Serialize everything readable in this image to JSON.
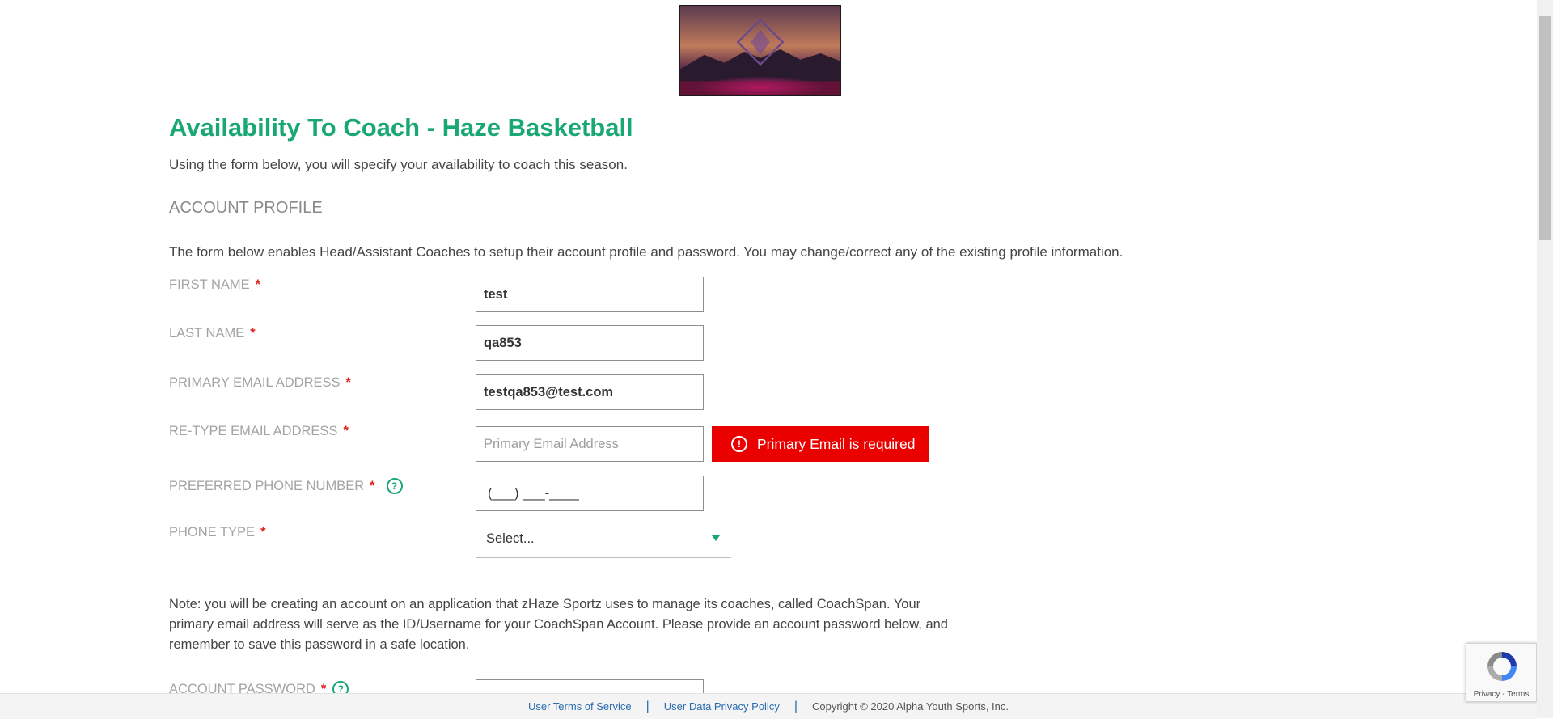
{
  "header": {
    "title": "Availability To Coach - Haze Basketball",
    "intro": "Using the form below, you will specify your availability to coach this season."
  },
  "section": {
    "heading": "ACCOUNT PROFILE",
    "description": "The form below enables Head/Assistant Coaches to setup their account profile and password. You may change/correct any of the existing profile information."
  },
  "form": {
    "required_marker": "*",
    "first_name": {
      "label": "FIRST NAME",
      "value": "test"
    },
    "last_name": {
      "label": "LAST NAME",
      "value": "qa853"
    },
    "primary_email": {
      "label": "PRIMARY EMAIL ADDRESS",
      "value": "testqa853@test.com"
    },
    "retype_email": {
      "label": "RE-TYPE EMAIL ADDRESS",
      "value": "",
      "placeholder": "Primary Email Address",
      "error": "Primary Email is required"
    },
    "phone": {
      "label": "PREFERRED PHONE NUMBER",
      "value": "(___) ___-____"
    },
    "phone_type": {
      "label": "PHONE TYPE",
      "selected": "Select..."
    },
    "account_password": {
      "label": "ACCOUNT PASSWORD"
    }
  },
  "note": "Note: you will be creating an account on an application that zHaze Sportz uses to manage its coaches, called CoachSpan. Your primary email address will serve as the ID/Username for your CoachSpan Account. Please provide an account password below, and remember to save this password in a safe location.",
  "footer": {
    "terms": "User Terms of Service",
    "privacy": "User Data Privacy Policy",
    "copyright": "Copyright © 2020 Alpha Youth Sports, Inc.",
    "separator": "|"
  },
  "recaptcha": {
    "links": "Privacy - Terms"
  },
  "icons": {
    "help": "question-circle-icon",
    "error": "exclamation-circle-icon",
    "dropdown": "caret-down-icon"
  },
  "colors": {
    "accent": "#1aa872",
    "error": "#eb0000",
    "required": "#e0201a",
    "link": "#2b6cb0"
  }
}
